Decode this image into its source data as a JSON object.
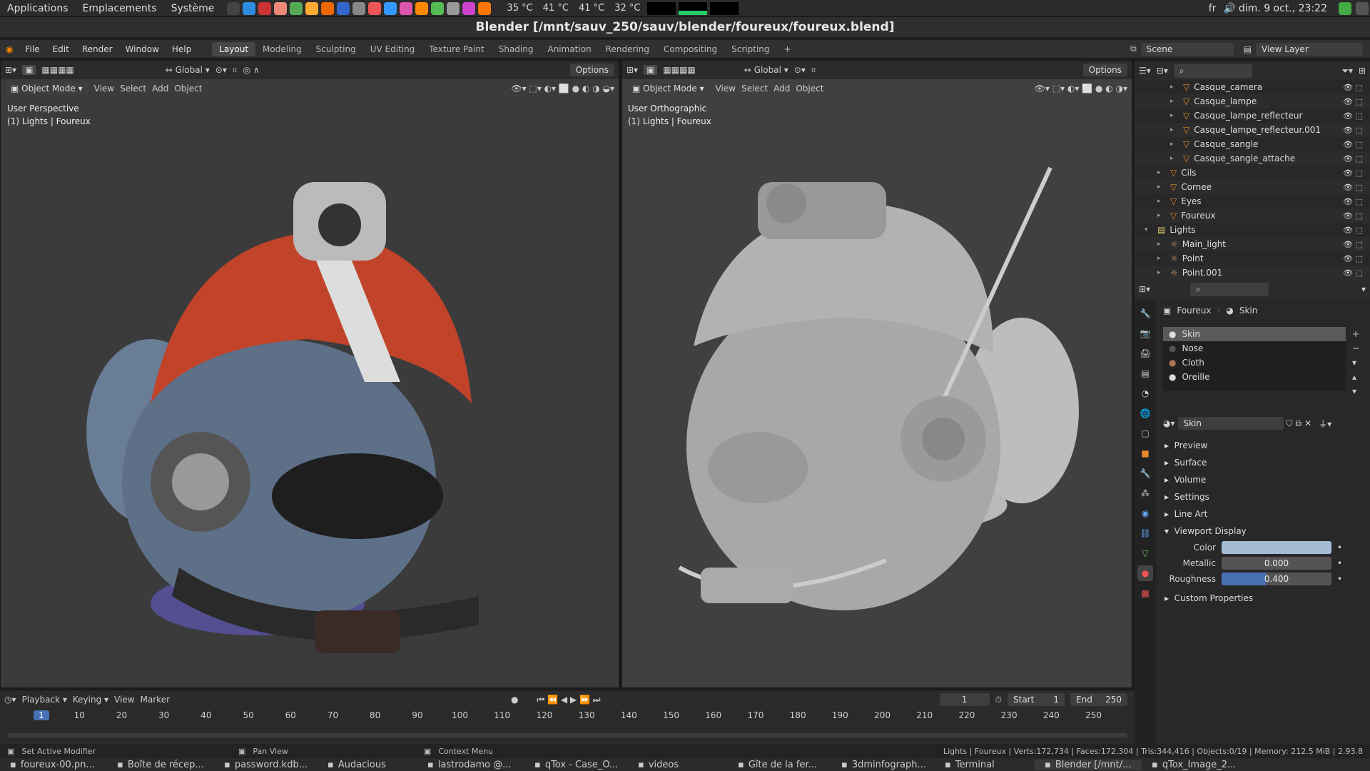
{
  "os": {
    "menus": [
      "Applications",
      "Emplacements",
      "Système"
    ],
    "temps": [
      "35 °C",
      "41 °C",
      "41 °C",
      "32 °C"
    ],
    "lang": "fr",
    "clock": "dim. 9 oct., 23:22"
  },
  "window_title": "Blender [/mnt/sauv_250/sauv/blender/foureux/foureux.blend]",
  "menu": [
    "File",
    "Edit",
    "Render",
    "Window",
    "Help"
  ],
  "workspaces": [
    "Layout",
    "Modeling",
    "Sculpting",
    "UV Editing",
    "Texture Paint",
    "Shading",
    "Animation",
    "Rendering",
    "Compositing",
    "Scripting",
    "+"
  ],
  "scene": "Scene",
  "view_layer": "View Layer",
  "viewport_left": {
    "transform": "Global",
    "options": "Options",
    "mode": "Object Mode",
    "menus": [
      "View",
      "Select",
      "Add",
      "Object"
    ],
    "overlay1": "User Perspective",
    "overlay2": "(1) Lights | Foureux"
  },
  "viewport_right": {
    "transform": "Global",
    "options": "Options",
    "mode": "Object Mode",
    "menus": [
      "View",
      "Select",
      "Add",
      "Object"
    ],
    "overlay1": "User Orthographic",
    "overlay2": "(1) Lights | Foureux"
  },
  "outliner": [
    {
      "name": "Casque_camera",
      "indent": 2
    },
    {
      "name": "Casque_lampe",
      "indent": 2
    },
    {
      "name": "Casque_lampe_reflecteur",
      "indent": 2
    },
    {
      "name": "Casque_lampe_reflecteur.001",
      "indent": 2
    },
    {
      "name": "Casque_sangle",
      "indent": 2
    },
    {
      "name": "Casque_sangle_attache",
      "indent": 2
    },
    {
      "name": "Cils",
      "indent": 1
    },
    {
      "name": "Cornee",
      "indent": 1
    },
    {
      "name": "Eyes",
      "indent": 1
    },
    {
      "name": "Foureux",
      "indent": 1
    },
    {
      "name": "Lights",
      "indent": 0,
      "collection": true
    },
    {
      "name": "Main_light",
      "indent": 1,
      "light": true
    },
    {
      "name": "Point",
      "indent": 1,
      "light": true
    },
    {
      "name": "Point.001",
      "indent": 1,
      "light": true
    }
  ],
  "props": {
    "object": "Foureux",
    "material": "Skin",
    "slots": [
      "Skin",
      "Nose",
      "Cloth",
      "Oreille"
    ],
    "mat_name": "Skin",
    "sections": [
      "Preview",
      "Surface",
      "Volume",
      "Settings",
      "Line Art"
    ],
    "viewport_display": "Viewport Display",
    "color_label": "Color",
    "metallic_label": "Metallic",
    "metallic": "0.000",
    "roughness_label": "Roughness",
    "roughness": "0.400",
    "roughness_fraction": 0.4,
    "custom": "Custom Properties"
  },
  "timeline": {
    "menus": [
      "Playback",
      "Keying",
      "View",
      "Marker"
    ],
    "current": "1",
    "start_label": "Start",
    "start": "1",
    "end_label": "End",
    "end": "250",
    "ticks": [
      "1",
      "10",
      "20",
      "30",
      "40",
      "50",
      "60",
      "70",
      "80",
      "90",
      "100",
      "110",
      "120",
      "130",
      "140",
      "150",
      "160",
      "170",
      "180",
      "190",
      "200",
      "210",
      "220",
      "230",
      "240",
      "250"
    ]
  },
  "status": {
    "s1": "Set Active Modifier",
    "s2": "Pan View",
    "s3": "Context Menu",
    "stats": "Lights | Foureux | Verts:172,734 | Faces:172,304 | Tris:344,416 | Objects:0/19 | Memory: 212.5 MiB | 2.93.8"
  },
  "taskbar": [
    "foureux-00.pn...",
    "Boîte de récep...",
    "password.kdb...",
    "Audacious",
    "lastrodamo @...",
    "qTox - Case_O...",
    "videos",
    "Gîte de la fer...",
    "3dminfograph...",
    "Terminal",
    "Blender [/mnt/...",
    "qTox_Image_2..."
  ]
}
